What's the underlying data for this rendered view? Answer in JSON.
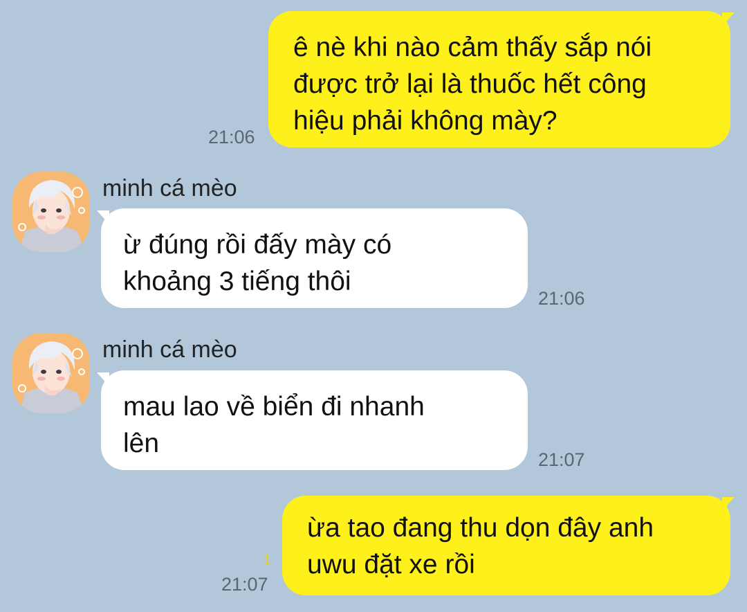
{
  "messages": [
    {
      "direction": "outgoing",
      "text": "ê nè khi nào cảm thấy sắp nói\nđược trở lại là thuốc hết công\nhiệu phải không mày?",
      "time": "21:06"
    },
    {
      "direction": "incoming",
      "sender": "minh cá mèo",
      "avatar": "anime-boy-avatar",
      "text": "ừ đúng rồi đấy mày có\nkhoảng 3 tiếng thôi",
      "time": "21:06"
    },
    {
      "direction": "incoming",
      "sender": "minh cá mèo",
      "avatar": "anime-boy-avatar",
      "text": "mau lao về biển đi nhanh\nlên",
      "time": "21:07"
    },
    {
      "direction": "outgoing",
      "text": "ừa tao đang thu dọn đây anh\nuwu đặt xe rồi",
      "time": "21:07",
      "unread_count": "1"
    }
  ],
  "colors": {
    "background": "#b2c7da",
    "outgoing_bubble": "#fef01b",
    "incoming_bubble": "#ffffff",
    "timestamp": "#5b6670",
    "unread": "#e6cf2b"
  }
}
